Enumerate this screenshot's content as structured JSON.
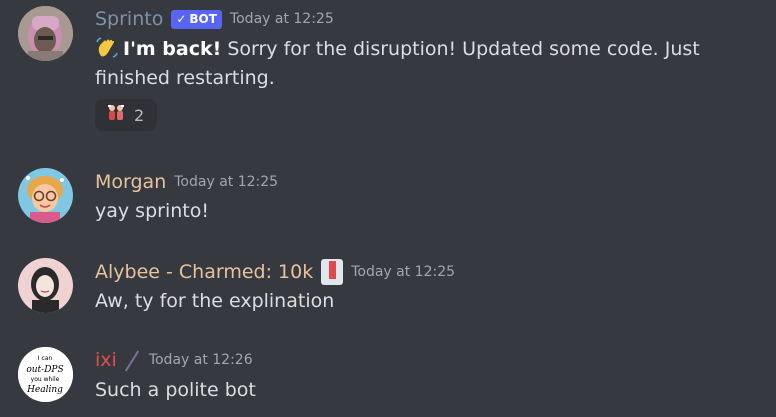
{
  "messages": [
    {
      "username": "Sprinto",
      "username_color": "#7f93a6",
      "bot_tag": "BOT",
      "timestamp": "Today at 12:25",
      "emoji": "waving-hand",
      "text_bold": "I'm back!",
      "text": " Sorry for the disruption! Updated some code. Just finished restarting.",
      "reaction": {
        "emoji": "party-figures",
        "count": "2"
      }
    },
    {
      "username": "Morgan",
      "username_color": "#e8c29c",
      "timestamp": "Today at 12:25",
      "text": "yay sprinto!"
    },
    {
      "username": "Alybee - Charmed: 10k",
      "username_color": "#e8c29c",
      "badge": "book-icon",
      "timestamp": "Today at 12:25",
      "text": "Aw, ty for the explination"
    },
    {
      "username": "ixi",
      "username_color": "#e84b4b",
      "badge": "quill-icon",
      "timestamp": "Today at 12:26",
      "text": "Such a polite bot",
      "avatar_text": [
        "I can",
        "out-DPS",
        "you while",
        "Healing"
      ]
    }
  ]
}
